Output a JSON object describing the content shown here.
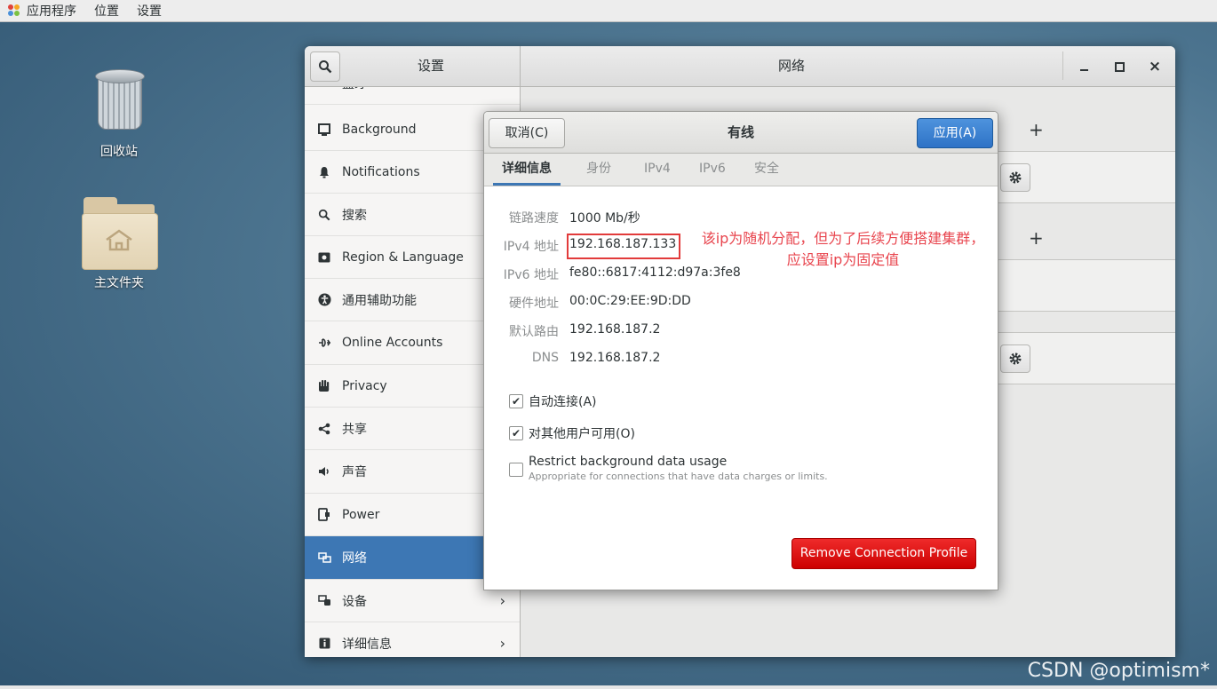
{
  "topbar": {
    "menus": [
      "应用程序",
      "位置",
      "设置"
    ]
  },
  "desktop": {
    "icons": [
      {
        "label": "回收站",
        "icon": "trash-icon"
      },
      {
        "label": "主文件夹",
        "icon": "home-folder-icon"
      }
    ]
  },
  "settings_window": {
    "left_title": "设置",
    "right_title": "网络",
    "window_buttons": {
      "minimize": "–",
      "maximize": "□",
      "close": "×"
    },
    "sidebar": {
      "partial_top_label": "蓝牙",
      "items": [
        {
          "label": "Background",
          "icon": "background-icon"
        },
        {
          "label": "Notifications",
          "icon": "bell-icon"
        },
        {
          "label": "搜索",
          "icon": "search-icon"
        },
        {
          "label": "Region & Language",
          "icon": "region-icon"
        },
        {
          "label": "通用辅助功能",
          "icon": "accessibility-icon"
        },
        {
          "label": "Online Accounts",
          "icon": "online-accounts-icon"
        },
        {
          "label": "Privacy",
          "icon": "hand-icon"
        },
        {
          "label": "共享",
          "icon": "share-icon"
        },
        {
          "label": "声音",
          "icon": "speaker-icon"
        },
        {
          "label": "Power",
          "icon": "power-icon"
        },
        {
          "label": "网络",
          "icon": "network-icon",
          "selected": true
        },
        {
          "label": "设备",
          "icon": "devices-icon",
          "chevron": "›"
        },
        {
          "label": "详细信息",
          "icon": "info-icon",
          "chevron": "›"
        }
      ]
    },
    "main": {
      "plus_label": "+"
    }
  },
  "dialog": {
    "cancel_label": "取消(C)",
    "title": "有线",
    "apply_label": "应用(A)",
    "tabs": [
      "详细信息",
      "身份",
      "IPv4",
      "IPv6",
      "安全"
    ],
    "active_tab": "详细信息",
    "details": [
      {
        "label": "链路速度",
        "value": "1000 Mb/秒"
      },
      {
        "label": "IPv4 地址",
        "value": "192.168.187.133"
      },
      {
        "label": "IPv6 地址",
        "value": "fe80::6817:4112:d97a:3fe8"
      },
      {
        "label": "硬件地址",
        "value": "00:0C:29:EE:9D:DD"
      },
      {
        "label": "默认路由",
        "value": "192.168.187.2"
      },
      {
        "label": "DNS",
        "value": "192.168.187.2"
      }
    ],
    "annotation_line1": "该ip为随机分配，但为了后续方便搭建集群，",
    "annotation_line2": "应设置ip为固定值",
    "checkboxes": [
      {
        "label": "自动连接(A)",
        "checked": true
      },
      {
        "label": "对其他用户可用(O)",
        "checked": true
      },
      {
        "label": "Restrict background data usage",
        "sublabel": "Appropriate for connections that have data charges or limits.",
        "checked": false
      }
    ],
    "remove_label": "Remove Connection Profile",
    "colors": {
      "accent": "#3d77b4",
      "apply": "#2e72c6",
      "danger": "#cc0000",
      "annotation": "#e8454e"
    }
  },
  "watermark": "CSDN @optimism*"
}
